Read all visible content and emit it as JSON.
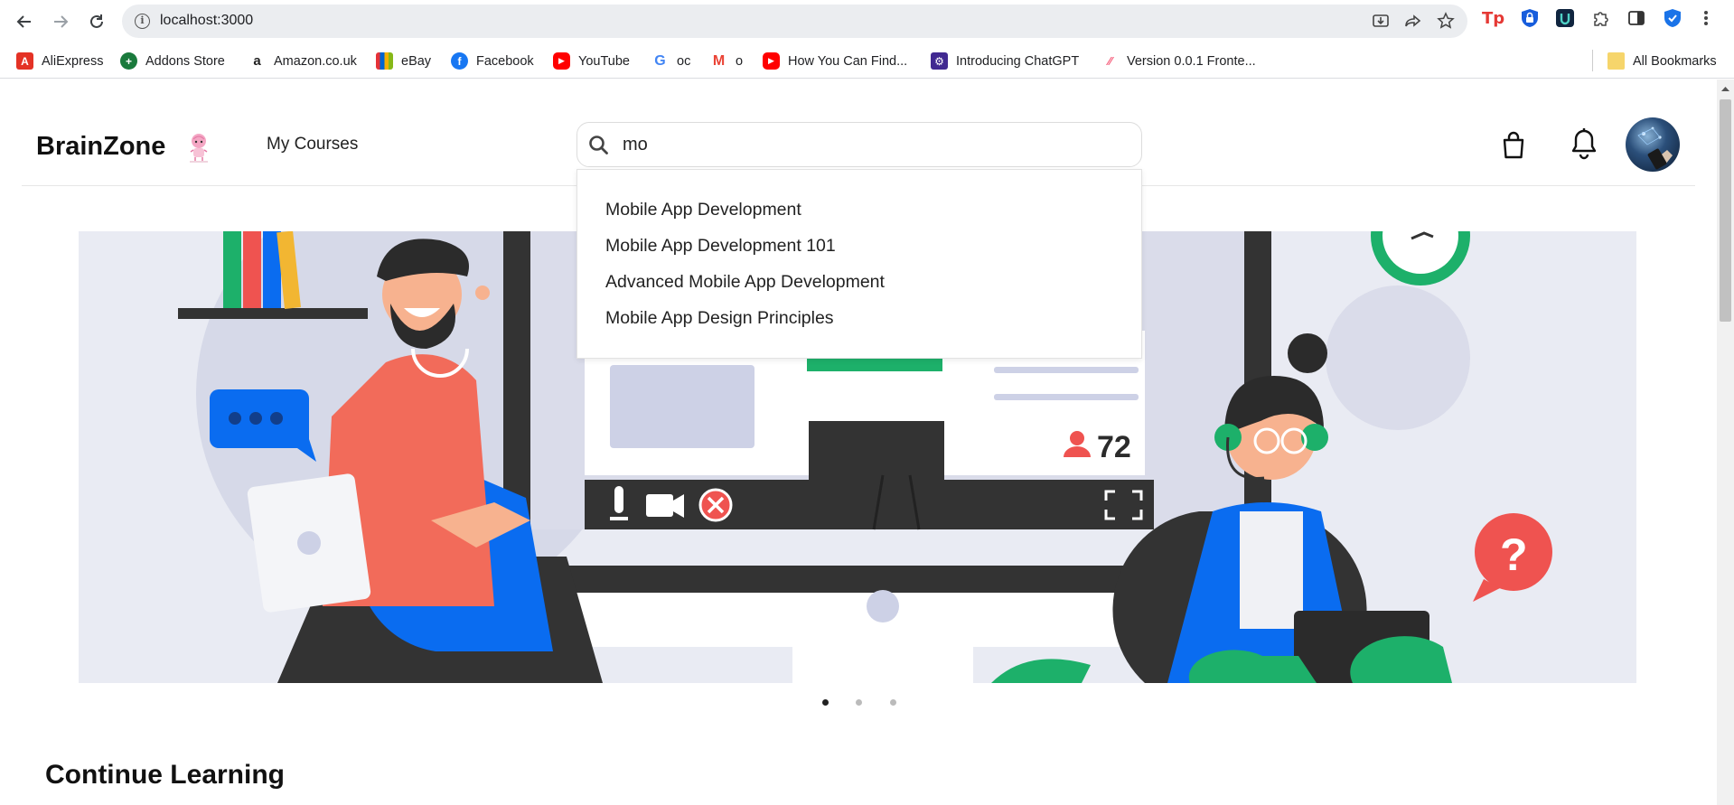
{
  "browser": {
    "url": "localhost:3000",
    "bookmarks": [
      {
        "label": "AliExpress",
        "icon": "aliexpress-icon",
        "color": "#e43225"
      },
      {
        "label": "Addons Store",
        "icon": "addons-store-icon",
        "color": "#1a7a3c"
      },
      {
        "label": "Amazon.co.uk",
        "icon": "amazon-icon",
        "color": "#222222"
      },
      {
        "label": "eBay",
        "icon": "ebay-icon",
        "color": "#e53238"
      },
      {
        "label": "Facebook",
        "icon": "facebook-icon",
        "color": "#1877f2"
      },
      {
        "label": "YouTube",
        "icon": "youtube-icon",
        "color": "#ff0000"
      },
      {
        "label": "oc",
        "icon": "google-icon",
        "color": "#4285f4"
      },
      {
        "label": "o",
        "icon": "gmail-icon",
        "color": "#ea4335"
      },
      {
        "label": "How You Can Find...",
        "icon": "youtube-icon",
        "color": "#ff0000"
      },
      {
        "label": "Introducing ChatGPT",
        "icon": "chatgpt-icon",
        "color": "#412991"
      },
      {
        "label": "Version 0.0.1 Fronte...",
        "icon": "monday-icon",
        "color": "#f65f7c"
      }
    ],
    "all_bookmarks": "All Bookmarks"
  },
  "header": {
    "brand": "BrainZone",
    "my_courses": "My Courses",
    "search_value": "mo"
  },
  "search_suggestions": [
    "Mobile App Development",
    "Mobile App Development 101",
    "Advanced Mobile App Development",
    "Mobile App Design Principles"
  ],
  "banner": {
    "participants": "72",
    "active_slide": 1,
    "slide_count": 3
  },
  "sections": {
    "continue_learning": "Continue Learning"
  },
  "colors": {
    "accent_green": "#1db06a",
    "accent_blue": "#0a6cf0",
    "accent_red": "#ef5350"
  }
}
